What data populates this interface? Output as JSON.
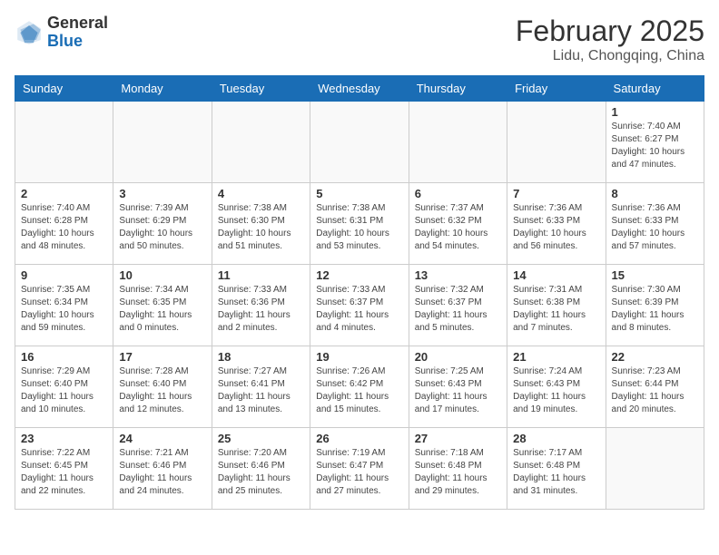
{
  "header": {
    "logo_general": "General",
    "logo_blue": "Blue",
    "title": "February 2025",
    "subtitle": "Lidu, Chongqing, China"
  },
  "weekdays": [
    "Sunday",
    "Monday",
    "Tuesday",
    "Wednesday",
    "Thursday",
    "Friday",
    "Saturday"
  ],
  "weeks": [
    [
      {
        "day": "",
        "info": "",
        "empty": true
      },
      {
        "day": "",
        "info": "",
        "empty": true
      },
      {
        "day": "",
        "info": "",
        "empty": true
      },
      {
        "day": "",
        "info": "",
        "empty": true
      },
      {
        "day": "",
        "info": "",
        "empty": true
      },
      {
        "day": "",
        "info": "",
        "empty": true
      },
      {
        "day": "1",
        "info": "Sunrise: 7:40 AM\nSunset: 6:27 PM\nDaylight: 10 hours and 47 minutes."
      }
    ],
    [
      {
        "day": "2",
        "info": "Sunrise: 7:40 AM\nSunset: 6:28 PM\nDaylight: 10 hours and 48 minutes."
      },
      {
        "day": "3",
        "info": "Sunrise: 7:39 AM\nSunset: 6:29 PM\nDaylight: 10 hours and 50 minutes."
      },
      {
        "day": "4",
        "info": "Sunrise: 7:38 AM\nSunset: 6:30 PM\nDaylight: 10 hours and 51 minutes."
      },
      {
        "day": "5",
        "info": "Sunrise: 7:38 AM\nSunset: 6:31 PM\nDaylight: 10 hours and 53 minutes."
      },
      {
        "day": "6",
        "info": "Sunrise: 7:37 AM\nSunset: 6:32 PM\nDaylight: 10 hours and 54 minutes."
      },
      {
        "day": "7",
        "info": "Sunrise: 7:36 AM\nSunset: 6:33 PM\nDaylight: 10 hours and 56 minutes."
      },
      {
        "day": "8",
        "info": "Sunrise: 7:36 AM\nSunset: 6:33 PM\nDaylight: 10 hours and 57 minutes."
      }
    ],
    [
      {
        "day": "9",
        "info": "Sunrise: 7:35 AM\nSunset: 6:34 PM\nDaylight: 10 hours and 59 minutes."
      },
      {
        "day": "10",
        "info": "Sunrise: 7:34 AM\nSunset: 6:35 PM\nDaylight: 11 hours and 0 minutes."
      },
      {
        "day": "11",
        "info": "Sunrise: 7:33 AM\nSunset: 6:36 PM\nDaylight: 11 hours and 2 minutes."
      },
      {
        "day": "12",
        "info": "Sunrise: 7:33 AM\nSunset: 6:37 PM\nDaylight: 11 hours and 4 minutes."
      },
      {
        "day": "13",
        "info": "Sunrise: 7:32 AM\nSunset: 6:37 PM\nDaylight: 11 hours and 5 minutes."
      },
      {
        "day": "14",
        "info": "Sunrise: 7:31 AM\nSunset: 6:38 PM\nDaylight: 11 hours and 7 minutes."
      },
      {
        "day": "15",
        "info": "Sunrise: 7:30 AM\nSunset: 6:39 PM\nDaylight: 11 hours and 8 minutes."
      }
    ],
    [
      {
        "day": "16",
        "info": "Sunrise: 7:29 AM\nSunset: 6:40 PM\nDaylight: 11 hours and 10 minutes."
      },
      {
        "day": "17",
        "info": "Sunrise: 7:28 AM\nSunset: 6:40 PM\nDaylight: 11 hours and 12 minutes."
      },
      {
        "day": "18",
        "info": "Sunrise: 7:27 AM\nSunset: 6:41 PM\nDaylight: 11 hours and 13 minutes."
      },
      {
        "day": "19",
        "info": "Sunrise: 7:26 AM\nSunset: 6:42 PM\nDaylight: 11 hours and 15 minutes."
      },
      {
        "day": "20",
        "info": "Sunrise: 7:25 AM\nSunset: 6:43 PM\nDaylight: 11 hours and 17 minutes."
      },
      {
        "day": "21",
        "info": "Sunrise: 7:24 AM\nSunset: 6:43 PM\nDaylight: 11 hours and 19 minutes."
      },
      {
        "day": "22",
        "info": "Sunrise: 7:23 AM\nSunset: 6:44 PM\nDaylight: 11 hours and 20 minutes."
      }
    ],
    [
      {
        "day": "23",
        "info": "Sunrise: 7:22 AM\nSunset: 6:45 PM\nDaylight: 11 hours and 22 minutes."
      },
      {
        "day": "24",
        "info": "Sunrise: 7:21 AM\nSunset: 6:46 PM\nDaylight: 11 hours and 24 minutes."
      },
      {
        "day": "25",
        "info": "Sunrise: 7:20 AM\nSunset: 6:46 PM\nDaylight: 11 hours and 25 minutes."
      },
      {
        "day": "26",
        "info": "Sunrise: 7:19 AM\nSunset: 6:47 PM\nDaylight: 11 hours and 27 minutes."
      },
      {
        "day": "27",
        "info": "Sunrise: 7:18 AM\nSunset: 6:48 PM\nDaylight: 11 hours and 29 minutes."
      },
      {
        "day": "28",
        "info": "Sunrise: 7:17 AM\nSunset: 6:48 PM\nDaylight: 11 hours and 31 minutes."
      },
      {
        "day": "",
        "info": "",
        "empty": true
      }
    ]
  ]
}
